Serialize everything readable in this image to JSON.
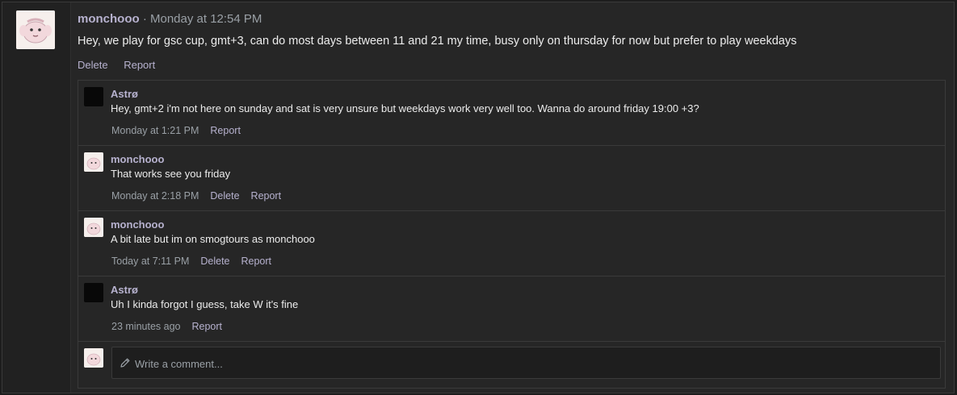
{
  "post": {
    "username": "monchooo",
    "separator": " · ",
    "timestamp": "Monday at 12:54 PM",
    "text": "Hey, we play for gsc cup, gmt+3, can do most days between 11 and 21 my time, busy only on thursday for now but prefer to play weekdays",
    "actions": {
      "delete": "Delete",
      "report": "Report"
    }
  },
  "comments": [
    {
      "username": "Astrø",
      "avatar": "black-avatar",
      "text": "Hey, gmt+2 i'm not here on sunday and sat is very unsure but weekdays work very well too. Wanna do around friday 19:00 +3?",
      "time": "Monday at 1:21 PM",
      "report": "Report"
    },
    {
      "username": "monchooo",
      "avatar": "pink-creature-avatar",
      "text": "That works see you friday",
      "time": "Monday at 2:18 PM",
      "delete": "Delete",
      "report": "Report"
    },
    {
      "username": "monchooo",
      "avatar": "pink-creature-avatar",
      "text": "A bit late but im on smogtours as monchooo",
      "time": "Today at 7:11 PM",
      "delete": "Delete",
      "report": "Report"
    },
    {
      "username": "Astrø",
      "avatar": "black-avatar",
      "text": "Uh I kinda forgot I guess, take W it's fine",
      "time": "23 minutes ago",
      "report": "Report"
    }
  ],
  "composer": {
    "placeholder": "Write a comment...",
    "icon": "pencil-icon"
  },
  "colors": {
    "background": "#262626",
    "username": "#b7b2cf",
    "meta": "#9aa0a6",
    "text": "#ececec"
  }
}
